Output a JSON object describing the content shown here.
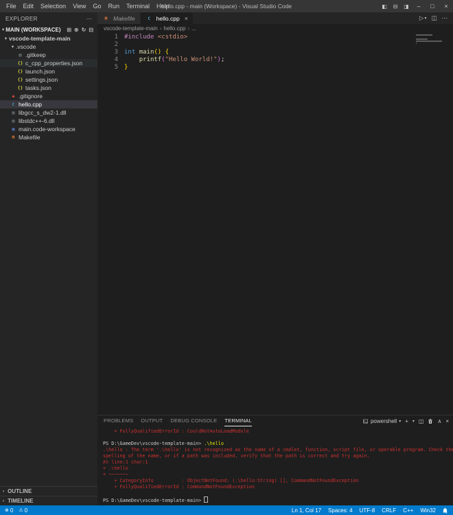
{
  "titlebar": {
    "menus": [
      "File",
      "Edit",
      "Selection",
      "View",
      "Go",
      "Run",
      "Terminal",
      "Help"
    ],
    "title": "hello.cpp - main (Workspace) - Visual Studio Code"
  },
  "explorer": {
    "title": "EXPLORER",
    "section": "MAIN (WORKSPACE)",
    "items": [
      {
        "label": "vscode-template-main",
        "kind": "folder",
        "indent": 0,
        "expanded": true
      },
      {
        "label": ".vscode",
        "kind": "folder",
        "indent": 1,
        "expanded": true
      },
      {
        "label": ".gitkeep",
        "kind": "file",
        "icon": "doc",
        "indent": 2
      },
      {
        "label": "c_cpp_properties.json",
        "kind": "file",
        "icon": "json",
        "indent": 2,
        "subtle": true
      },
      {
        "label": "launch.json",
        "kind": "file",
        "icon": "json",
        "indent": 2
      },
      {
        "label": "settings.json",
        "kind": "file",
        "icon": "json",
        "indent": 2
      },
      {
        "label": "tasks.json",
        "kind": "file",
        "icon": "json",
        "indent": 2
      },
      {
        "label": ".gitignore",
        "kind": "file",
        "icon": "git",
        "indent": 1
      },
      {
        "label": "hello.cpp",
        "kind": "file",
        "icon": "cpp",
        "indent": 1,
        "selected": true
      },
      {
        "label": "libgcc_s_dw2-1.dll",
        "kind": "file",
        "icon": "doc",
        "indent": 1
      },
      {
        "label": "libstdc++-6.dll",
        "kind": "file",
        "icon": "doc",
        "indent": 1
      },
      {
        "label": "main.code-workspace",
        "kind": "file",
        "icon": "workspace",
        "indent": 1
      },
      {
        "label": "Makefile",
        "kind": "file",
        "icon": "makefile",
        "indent": 1
      }
    ],
    "bottom_sections": [
      "OUTLINE",
      "TIMELINE"
    ]
  },
  "editor": {
    "tabs": [
      {
        "label": "Makefile",
        "icon": "makefile",
        "active": false,
        "preview": true
      },
      {
        "label": "hello.cpp",
        "icon": "cpp",
        "active": true,
        "preview": false
      }
    ],
    "breadcrumbs": [
      "vscode-template-main",
      "hello.cpp",
      "..."
    ],
    "code": [
      {
        "num": "1",
        "tokens": [
          [
            "#include",
            "pp"
          ],
          [
            " ",
            "d"
          ],
          [
            "<cstdio>",
            "str"
          ]
        ]
      },
      {
        "num": "2",
        "tokens": []
      },
      {
        "num": "3",
        "tokens": [
          [
            "int",
            "kw"
          ],
          [
            " ",
            "d"
          ],
          [
            "main",
            "fn"
          ],
          [
            "()",
            "b1"
          ],
          [
            " ",
            "d"
          ],
          [
            "{",
            "b1"
          ]
        ]
      },
      {
        "num": "4",
        "tokens": [
          [
            "    ",
            "d"
          ],
          [
            "printf",
            "fn"
          ],
          [
            "(",
            "b2"
          ],
          [
            "\"Hello World!\"",
            "str"
          ],
          [
            ")",
            "b2"
          ],
          [
            ";",
            "d"
          ]
        ]
      },
      {
        "num": "5",
        "tokens": [
          [
            "}",
            "b1"
          ]
        ]
      }
    ]
  },
  "panel": {
    "tabs": [
      {
        "label": "PROBLEMS",
        "active": false
      },
      {
        "label": "OUTPUT",
        "active": false
      },
      {
        "label": "DEBUG CONSOLE",
        "active": false
      },
      {
        "label": "TERMINAL",
        "active": true
      }
    ],
    "shell_label": "powershell",
    "terminal_lines": [
      [
        [
          "    + FullyQualifiedErrorId : CouldNotAutoLoadModule",
          "err"
        ]
      ],
      [],
      [
        [
          "PS D:\\GameDev\\vscode-template-main> ",
          "p"
        ],
        [
          ".\\hello",
          "cmd"
        ]
      ],
      [
        [
          ".\\hello : The term '.\\hello' is not recognized as the name of a cmdlet, function, script file, or operable program. Check the",
          "err"
        ]
      ],
      [
        [
          "spelling of the name, or if a path was included, verify that the path is correct and try again.",
          "err"
        ]
      ],
      [
        [
          "At line:1 char:1",
          "err"
        ]
      ],
      [
        [
          "+ .\\hello",
          "err"
        ]
      ],
      [
        [
          "+ ~~~~~~~",
          "err"
        ]
      ],
      [
        [
          "    + CategoryInfo          : ObjectNotFound: (.\\hello:String) [], CommandNotFoundException",
          "err"
        ]
      ],
      [
        [
          "    + FullyQualifiedErrorId : CommandNotFoundException",
          "err"
        ]
      ],
      [],
      [
        [
          "PS D:\\GameDev\\vscode-template-main> ",
          "p"
        ],
        [
          "",
          "cursor"
        ]
      ]
    ]
  },
  "statusbar": {
    "left": [
      {
        "name": "errors",
        "icon": "error",
        "count": "0"
      },
      {
        "name": "warnings",
        "icon": "warning",
        "count": "0"
      }
    ],
    "right": [
      "Ln 1, Col 17",
      "Spaces: 4",
      "UTF-8",
      "CRLF",
      "C++",
      "Win32"
    ]
  },
  "icons": {
    "new-file": "⊞",
    "new-folder": "⊕",
    "refresh": "↻",
    "collapse-all": "⊟",
    "more": "⋯",
    "run": "▷",
    "chevron-down": "▾",
    "chevron-up": "∧",
    "chevron-right": "›",
    "split-editor": "◫",
    "close": "×",
    "minimize": "–",
    "maximize": "□",
    "layout-sidebar": "◧",
    "layout-panel": "⊟",
    "layout-secondary": "◨",
    "error": "⊗",
    "warning": "⚠",
    "plus": "+"
  },
  "colors": {
    "statusbar_bg": "#007ACC",
    "titlebar_bg": "#363636",
    "sidebar_bg": "#252526",
    "editor_bg": "#1E1E1E",
    "tab_inactive_bg": "#2D2D2D",
    "selection_bg": "#37373D",
    "terminal_error": "#CD3131",
    "terminal_command": "#E5E510",
    "cpp_icon_blue": "#519ABA",
    "makefile_icon_orange": "#E37933",
    "json_icon_yellow": "#CBCB41"
  }
}
